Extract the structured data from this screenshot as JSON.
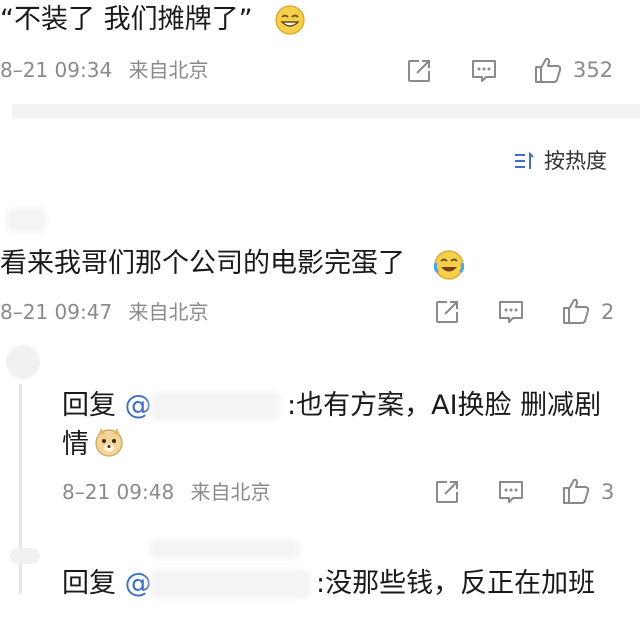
{
  "post": {
    "text": "“不装了 我们摊牌了”",
    "time": "8–21 09:34",
    "source": "来自北京",
    "likes": "352"
  },
  "sort": {
    "label": "按热度"
  },
  "comment": {
    "text": "看来我哥们那个公司的电影完蛋了",
    "time": "8–21 09:47",
    "source": "来自北京",
    "likes": "2"
  },
  "reply1": {
    "prefix": "回复",
    "mention": "@",
    "text": ":也有方案，AI换脸 删减剧",
    "text2": "情",
    "time": "8–21 09:48",
    "source": "来自北京",
    "likes": "3"
  },
  "reply2": {
    "prefix": "回复",
    "mention": "@",
    "text": ":没那些钱，反正在加班"
  },
  "icons": {
    "share": "share-icon",
    "comment": "comment-icon",
    "like": "thumbs-up-icon",
    "sort": "sort-icon",
    "emoji_grin": "grin-emoji-icon",
    "emoji_laugh_cry": "laugh-cry-emoji-icon",
    "emoji_doge": "doge-emoji-icon"
  },
  "colors": {
    "text_primary": "#1a1a1a",
    "text_meta": "#8a8a8a",
    "divider": "#f2f2f2"
  }
}
